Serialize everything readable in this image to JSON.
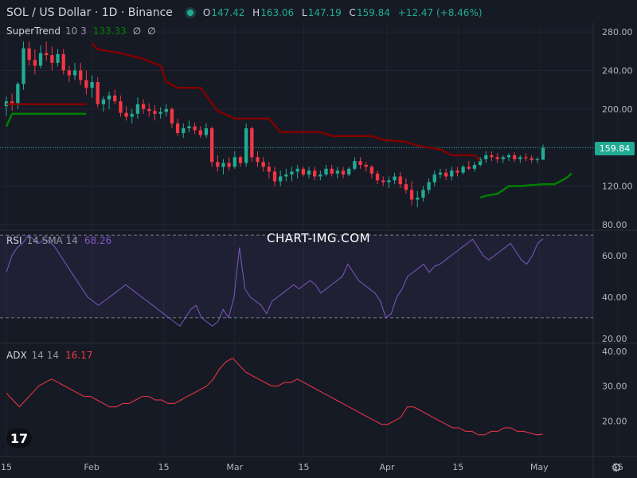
{
  "header": {
    "symbol": "SOL / US Dollar · 1D · Binance",
    "ohlc": {
      "o_label": "O",
      "o": "147.42",
      "h_label": "H",
      "h": "163.06",
      "l_label": "L",
      "l": "147.19",
      "c_label": "C",
      "c": "159.84",
      "change": "+12.47 (+8.46%)"
    }
  },
  "supertrend_legend": {
    "name": "SuperTrend",
    "params": "10 3",
    "value": "133.33",
    "icon1": "∅",
    "icon2": "∅"
  },
  "rsi_legend": {
    "name": "RSI",
    "params": "14 SMA 14",
    "value": "68.26"
  },
  "adx_legend": {
    "name": "ADX",
    "params": "14 14",
    "value": "16.17"
  },
  "watermark": "CHART-IMG.COM",
  "last_price_label": "159.84",
  "colors": {
    "bg": "#161a25",
    "up": "#22ab94",
    "down": "#f23645",
    "st_up": "#008000",
    "st_down": "#800000",
    "rsi": "#7e57c2",
    "adx": "#f23645"
  },
  "chart_data": [
    {
      "type": "candlestick",
      "title": "SOL / US Dollar · 1D · Binance",
      "ylim": [
        75,
        290
      ],
      "y_ticks": [
        "80.00",
        "120.00",
        "160.00",
        "200.00",
        "240.00",
        "280.00"
      ],
      "x_ticks": [
        "15",
        "Feb",
        "15",
        "Mar",
        "15",
        "Apr",
        "15",
        "May",
        "15"
      ],
      "last_price": 159.84,
      "candles": [
        [
          203,
          213,
          193,
          208
        ],
        [
          208,
          216,
          198,
          204
        ],
        [
          204,
          228,
          200,
          226
        ],
        [
          226,
          270,
          220,
          263
        ],
        [
          263,
          270,
          245,
          251
        ],
        [
          251,
          262,
          236,
          245
        ],
        [
          245,
          266,
          242,
          258
        ],
        [
          258,
          270,
          250,
          256
        ],
        [
          256,
          265,
          240,
          248
        ],
        [
          248,
          262,
          244,
          257
        ],
        [
          257,
          262,
          236,
          240
        ],
        [
          240,
          245,
          228,
          235
        ],
        [
          235,
          248,
          230,
          240
        ],
        [
          240,
          248,
          225,
          230
        ],
        [
          230,
          240,
          215,
          222
        ],
        [
          222,
          235,
          212,
          228
        ],
        [
          228,
          233,
          202,
          205
        ],
        [
          205,
          213,
          197,
          210
        ],
        [
          210,
          218,
          200,
          214
        ],
        [
          214,
          220,
          205,
          208
        ],
        [
          208,
          214,
          192,
          196
        ],
        [
          196,
          203,
          188,
          192
        ],
        [
          192,
          200,
          185,
          195
        ],
        [
          195,
          212,
          190,
          205
        ],
        [
          205,
          210,
          195,
          200
        ],
        [
          200,
          206,
          192,
          198
        ],
        [
          198,
          204,
          188,
          195
        ],
        [
          195,
          202,
          190,
          197
        ],
        [
          197,
          205,
          192,
          200
        ],
        [
          200,
          202,
          180,
          185
        ],
        [
          185,
          190,
          172,
          175
        ],
        [
          175,
          185,
          170,
          180
        ],
        [
          180,
          188,
          176,
          182
        ],
        [
          182,
          186,
          174,
          178
        ],
        [
          178,
          182,
          170,
          173
        ],
        [
          173,
          185,
          170,
          180
        ],
        [
          180,
          182,
          140,
          145
        ],
        [
          145,
          152,
          135,
          140
        ],
        [
          140,
          148,
          132,
          144
        ],
        [
          144,
          150,
          136,
          140
        ],
        [
          140,
          156,
          138,
          150
        ],
        [
          150,
          152,
          140,
          144
        ],
        [
          144,
          185,
          140,
          180
        ],
        [
          180,
          182,
          145,
          150
        ],
        [
          150,
          156,
          140,
          145
        ],
        [
          145,
          150,
          135,
          140
        ],
        [
          140,
          145,
          128,
          135
        ],
        [
          135,
          140,
          120,
          125
        ],
        [
          125,
          136,
          120,
          130
        ],
        [
          130,
          138,
          125,
          132
        ],
        [
          132,
          140,
          125,
          135
        ],
        [
          135,
          142,
          128,
          138
        ],
        [
          138,
          140,
          130,
          132
        ],
        [
          132,
          140,
          128,
          136
        ],
        [
          136,
          140,
          126,
          130
        ],
        [
          130,
          136,
          126,
          132
        ],
        [
          132,
          142,
          130,
          138
        ],
        [
          138,
          142,
          130,
          133
        ],
        [
          133,
          140,
          128,
          136
        ],
        [
          136,
          140,
          128,
          132
        ],
        [
          132,
          140,
          130,
          138
        ],
        [
          138,
          150,
          136,
          146
        ],
        [
          146,
          150,
          138,
          142
        ],
        [
          142,
          145,
          135,
          140
        ],
        [
          140,
          142,
          128,
          133
        ],
        [
          133,
          136,
          122,
          126
        ],
        [
          126,
          130,
          120,
          124
        ],
        [
          124,
          130,
          118,
          126
        ],
        [
          126,
          134,
          122,
          130
        ],
        [
          130,
          135,
          118,
          122
        ],
        [
          122,
          128,
          112,
          116
        ],
        [
          116,
          125,
          100,
          106
        ],
        [
          106,
          115,
          98,
          108
        ],
        [
          108,
          120,
          104,
          116
        ],
        [
          116,
          128,
          112,
          124
        ],
        [
          124,
          136,
          120,
          132
        ],
        [
          132,
          138,
          128,
          134
        ],
        [
          134,
          138,
          126,
          130
        ],
        [
          130,
          140,
          126,
          136
        ],
        [
          136,
          140,
          130,
          134
        ],
        [
          134,
          142,
          132,
          140
        ],
        [
          140,
          146,
          136,
          138
        ],
        [
          138,
          145,
          135,
          142
        ],
        [
          142,
          150,
          140,
          148
        ],
        [
          148,
          156,
          144,
          152
        ],
        [
          152,
          156,
          146,
          150
        ],
        [
          150,
          154,
          144,
          148
        ],
        [
          148,
          152,
          144,
          150
        ],
        [
          150,
          154,
          146,
          152
        ],
        [
          152,
          155,
          145,
          148
        ],
        [
          148,
          152,
          144,
          150
        ],
        [
          150,
          154,
          146,
          149
        ],
        [
          149,
          152,
          144,
          147
        ],
        [
          147,
          150,
          144,
          148
        ],
        [
          147.42,
          163.06,
          147.19,
          159.84
        ]
      ],
      "supertrend_down": [
        [
          0,
          205
        ],
        [
          1,
          205
        ],
        [
          12,
          205
        ],
        [
          14,
          205
        ],
        [
          15,
          268
        ],
        [
          16,
          262
        ],
        [
          20,
          258
        ],
        [
          24,
          252
        ],
        [
          27,
          245
        ],
        [
          28,
          228
        ],
        [
          30,
          222
        ],
        [
          34,
          222
        ],
        [
          37,
          198
        ],
        [
          40,
          190
        ],
        [
          46,
          190
        ],
        [
          48,
          176
        ],
        [
          55,
          176
        ],
        [
          57,
          172
        ],
        [
          64,
          172
        ],
        [
          66,
          168
        ],
        [
          70,
          166
        ],
        [
          72,
          162
        ],
        [
          76,
          158
        ],
        [
          78,
          152
        ],
        [
          82,
          152
        ],
        [
          83,
          146
        ]
      ],
      "supertrend_up": [
        [
          0,
          182
        ],
        [
          1,
          195
        ],
        [
          2,
          195
        ],
        [
          14,
          195
        ],
        [
          83,
          108
        ],
        [
          84,
          110
        ],
        [
          86,
          112
        ],
        [
          88,
          120
        ],
        [
          90,
          120
        ],
        [
          94,
          122
        ],
        [
          96,
          122
        ],
        [
          98,
          128
        ],
        [
          99,
          133.33
        ]
      ]
    },
    {
      "type": "line",
      "title": "RSI",
      "ylim": [
        18,
        72
      ],
      "y_ticks": [
        "20.00",
        "40.00",
        "60.00"
      ],
      "bands": [
        30,
        70
      ],
      "values": [
        52,
        60,
        64,
        66,
        70,
        68,
        66,
        68,
        67,
        64,
        60,
        56,
        52,
        48,
        44,
        40,
        38,
        36,
        38,
        40,
        42,
        44,
        46,
        44,
        42,
        40,
        38,
        36,
        34,
        32,
        30,
        28,
        26,
        30,
        34,
        36,
        30,
        28,
        26,
        28,
        34,
        30,
        40,
        64,
        44,
        40,
        38,
        36,
        32,
        38,
        40,
        42,
        44,
        46,
        44,
        46,
        48,
        46,
        42,
        44,
        46,
        48,
        50,
        56,
        52,
        48,
        46,
        44,
        42,
        38,
        30,
        32,
        40,
        44,
        50,
        52,
        54,
        56,
        52,
        55,
        56,
        58,
        60,
        62,
        64,
        66,
        68,
        64,
        60,
        58,
        60,
        62,
        64,
        66,
        62,
        58,
        56,
        60,
        66,
        68.26
      ]
    },
    {
      "type": "line",
      "title": "ADX",
      "ylim": [
        10,
        42
      ],
      "y_ticks": [
        "20.00",
        "30.00",
        "40.00"
      ],
      "values": [
        28,
        26,
        24,
        26,
        28,
        30,
        31,
        32,
        31,
        30,
        29,
        28,
        27,
        27,
        26,
        25,
        24,
        24,
        25,
        25,
        26,
        27,
        27,
        26,
        26,
        25,
        25,
        26,
        27,
        28,
        29,
        30,
        32,
        35,
        37,
        38,
        36,
        34,
        33,
        32,
        31,
        30,
        30,
        31,
        31,
        32,
        31,
        30,
        29,
        28,
        27,
        26,
        25,
        24,
        23,
        22,
        21,
        20,
        19,
        19,
        20,
        21,
        24,
        24,
        23,
        22,
        21,
        20,
        19,
        18,
        18,
        17,
        17,
        16,
        16,
        17,
        17,
        18,
        18,
        17,
        17,
        16.5,
        16,
        16.17
      ]
    }
  ]
}
